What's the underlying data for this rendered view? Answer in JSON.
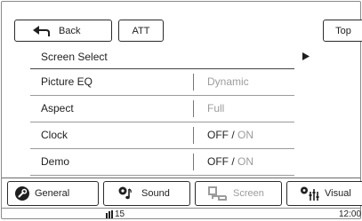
{
  "topbar": {
    "back_label": "Back",
    "att_label": "ATT",
    "top_label": "Top"
  },
  "title": "Screen Select",
  "rows": [
    {
      "label": "Picture EQ",
      "value": "Dynamic"
    },
    {
      "label": "Aspect",
      "value": "Full"
    },
    {
      "label": "Clock",
      "value_on_off": {
        "off": "OFF /",
        "on": "ON"
      }
    },
    {
      "label": "Demo",
      "value_on_off": {
        "off": "OFF /",
        "on": "ON"
      }
    }
  ],
  "tabs": {
    "general": "General",
    "sound": "Sound",
    "screen": "Screen",
    "visual": "Visual"
  },
  "status": {
    "volume": "15",
    "clock": "12:00"
  },
  "icons": {
    "back": "back-arrow-icon",
    "select": "right-triangle-icon",
    "general": "wrench-icon",
    "sound": "speaker-note-icon",
    "screen": "screen-icon",
    "visual": "sliders-icon",
    "volume": "volume-icon"
  },
  "colors": {
    "muted": "#9c9c9c",
    "text": "#1f1f1f"
  }
}
